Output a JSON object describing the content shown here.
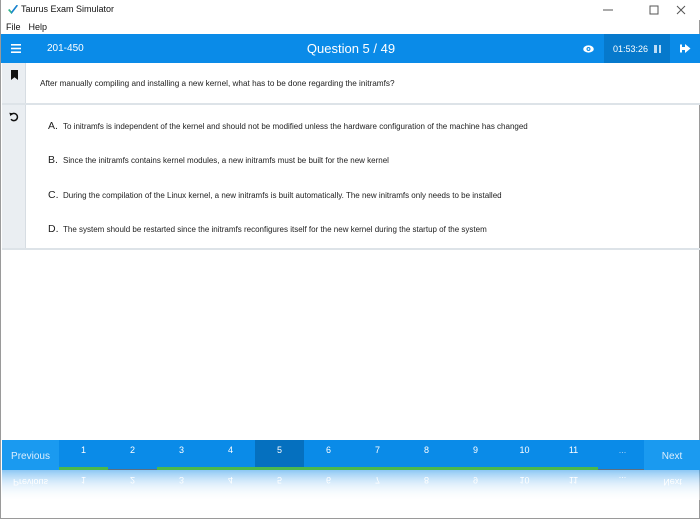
{
  "window": {
    "title": "Taurus Exam Simulator",
    "controls": {
      "minimize": "—",
      "maximize": "☐",
      "close": "✕"
    }
  },
  "menu": {
    "items": [
      "File",
      "Help"
    ]
  },
  "topbar": {
    "exam_code": "201-450",
    "question_label": "Question 5 / 49",
    "current_question": 5,
    "total_questions": 49,
    "timer": "01:53:26",
    "icons": {
      "menu": "hamburger-icon",
      "reveal": "eye-icon",
      "pause": "pause-icon",
      "exit": "exit-icon"
    }
  },
  "question": {
    "text": "After manually compiling and installing a new kernel, what has to be done regarding the initramfs?",
    "icons": {
      "bookmark": "bookmark-icon",
      "reset": "undo-icon"
    }
  },
  "answers": [
    {
      "letter": "A.",
      "text": "To initramfs is independent of the kernel and should not be modified unless the hardware configuration of the machine has changed"
    },
    {
      "letter": "B.",
      "text": "Since the initramfs contains kernel modules, a new initramfs must be built for the new kernel"
    },
    {
      "letter": "C.",
      "text": "During the compilation of the Linux kernel, a new initramfs is built automatically. The new initramfs only needs to be installed"
    },
    {
      "letter": "D.",
      "text": "The system should be restarted since the initramfs reconfigures itself for the new kernel during the startup of the system"
    }
  ],
  "navigation": {
    "previous_label": "Previous",
    "next_label": "Next",
    "pages": [
      {
        "label": "1",
        "answered": true,
        "active": false
      },
      {
        "label": "2",
        "answered": false,
        "active": false
      },
      {
        "label": "3",
        "answered": true,
        "active": false
      },
      {
        "label": "4",
        "answered": true,
        "active": false
      },
      {
        "label": "5",
        "answered": true,
        "active": true
      },
      {
        "label": "6",
        "answered": true,
        "active": false
      },
      {
        "label": "7",
        "answered": true,
        "active": false
      },
      {
        "label": "8",
        "answered": true,
        "active": false
      },
      {
        "label": "9",
        "answered": true,
        "active": false
      },
      {
        "label": "10",
        "answered": true,
        "active": false
      },
      {
        "label": "11",
        "answered": true,
        "active": false
      },
      {
        "label": "...",
        "answered": false,
        "active": false
      }
    ]
  },
  "colors": {
    "accent": "#0a8be8",
    "active_page": "#0570bf",
    "timer_bg": "#0679cc",
    "answered": "#4cb84c",
    "side_strip": "#eaeef2"
  }
}
